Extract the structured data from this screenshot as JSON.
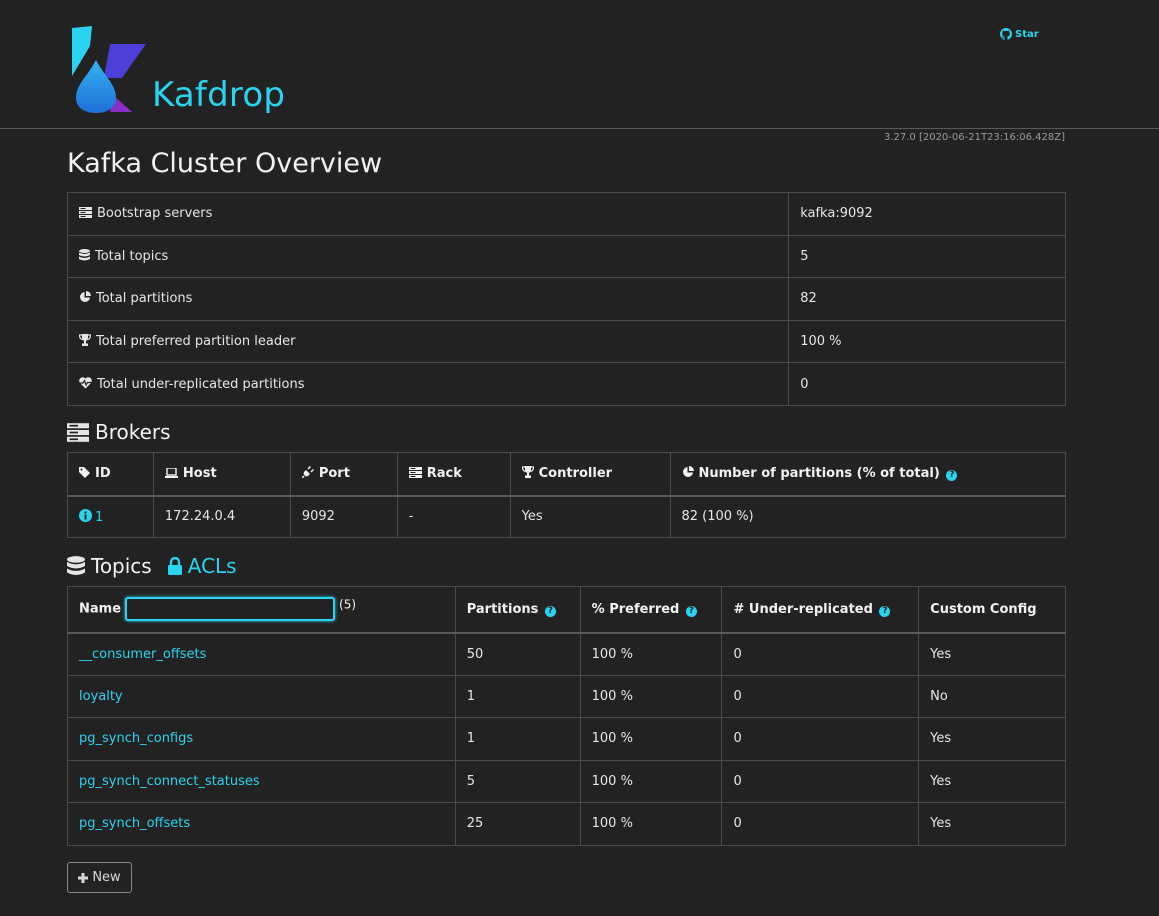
{
  "header": {
    "brand": "Kafdrop",
    "star_label": "Star",
    "version": "3.27.0 [2020-06-21T23:16:06.428Z]"
  },
  "page_title": "Kafka Cluster Overview",
  "overview": [
    {
      "icon": "server-icon",
      "label": "Bootstrap servers",
      "value": "kafka:9092"
    },
    {
      "icon": "database-icon",
      "label": "Total topics",
      "value": "5"
    },
    {
      "icon": "pie-chart-icon",
      "label": "Total partitions",
      "value": "82"
    },
    {
      "icon": "trophy-icon",
      "label": "Total preferred partition leader",
      "value": "100 %"
    },
    {
      "icon": "heartbeat-icon",
      "label": "Total under-replicated partitions",
      "value": "0"
    }
  ],
  "brokers": {
    "title": "Brokers",
    "headers": {
      "id": "ID",
      "host": "Host",
      "port": "Port",
      "rack": "Rack",
      "controller": "Controller",
      "partitions": "Number of partitions (% of total)"
    },
    "rows": [
      {
        "id": "1",
        "host": "172.24.0.4",
        "port": "9092",
        "rack": "-",
        "controller": "Yes",
        "partitions": "82 (100 %)"
      }
    ]
  },
  "topics": {
    "title": "Topics",
    "acls_label": "ACLs",
    "filter_value": "",
    "count": "(5)",
    "headers": {
      "name": "Name",
      "partitions": "Partitions",
      "preferred": "% Preferred",
      "under_replicated": "# Under-replicated",
      "custom_config": "Custom Config"
    },
    "rows": [
      {
        "name": "__consumer_offsets",
        "partitions": "50",
        "preferred": "100 %",
        "under": "0",
        "custom": "Yes"
      },
      {
        "name": "loyalty",
        "partitions": "1",
        "preferred": "100 %",
        "under": "0",
        "custom": "No"
      },
      {
        "name": "pg_synch_configs",
        "partitions": "1",
        "preferred": "100 %",
        "under": "0",
        "custom": "Yes"
      },
      {
        "name": "pg_synch_connect_statuses",
        "partitions": "5",
        "preferred": "100 %",
        "under": "0",
        "custom": "Yes"
      },
      {
        "name": "pg_synch_offsets",
        "partitions": "25",
        "preferred": "100 %",
        "under": "0",
        "custom": "Yes"
      }
    ]
  },
  "new_button_label": "New",
  "colors": {
    "accent": "#2ad4f0",
    "background": "#222222"
  }
}
